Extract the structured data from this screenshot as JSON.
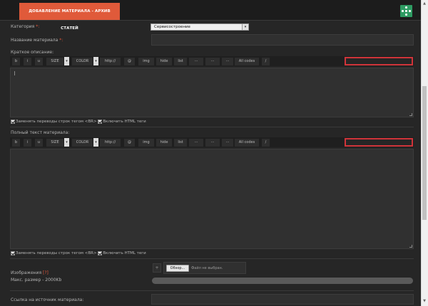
{
  "header": {
    "title": "ДОБАВЛЕНИЕ МАТЕРИАЛА - АРХИВ СТАТЕЙ",
    "icon": "grid-dots-icon",
    "icon_color": "#2e9b62",
    "accent": "#e05a3a"
  },
  "category": {
    "label": "Категория",
    "required": "*:",
    "selected": "Сервисостроение"
  },
  "title_field": {
    "label": "Название материала",
    "required": "*:",
    "value": ""
  },
  "short": {
    "label": "Краткое описание:",
    "toolbar": {
      "b": "b",
      "i": "i",
      "u": "u",
      "size": "SIZE",
      "color": "COLOR",
      "url": "http://",
      "email": "@",
      "img": "img",
      "hide": "hide",
      "list": "list",
      "dots": "···",
      "allcodes": "All codes",
      "slash": "/"
    },
    "value": ""
  },
  "options1": {
    "breaks": "Заменять переводы строк тегом <BR>",
    "html": "Включить HTML теги"
  },
  "full": {
    "label": "Полный текст материала:",
    "toolbar": {
      "b": "b",
      "i": "i",
      "u": "u",
      "size": "SIZE",
      "color": "COLOR",
      "url": "http://",
      "email": "@",
      "img": "img",
      "hide": "hide",
      "list": "list",
      "dots": "···",
      "allcodes": "All codes",
      "slash": "/"
    },
    "value": ""
  },
  "options2": {
    "breaks": "Заменять переводы строк тегом <BR>",
    "html": "Включить HTML теги"
  },
  "images": {
    "label": "Изображения",
    "help": "[?]",
    "max_label": "Макс. размер - 2000Kb",
    "plus": "+",
    "browse": "Обзор...",
    "no_file": "Файл не выбран.",
    "progress": 0
  },
  "source": {
    "label": "Ссылка на источник материала:",
    "value": ""
  }
}
